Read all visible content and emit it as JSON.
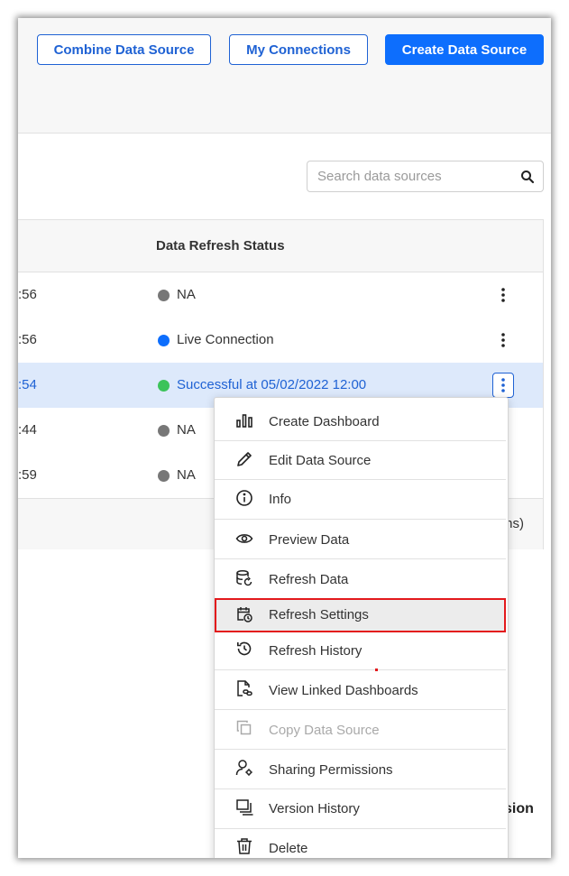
{
  "header": {
    "combine_label": "Combine Data Source",
    "connections_label": "My Connections",
    "create_label": "Create Data Source"
  },
  "search": {
    "placeholder": "Search data sources"
  },
  "table": {
    "status_header": "Data Refresh Status",
    "rows": [
      {
        "time_fragment": ":56",
        "status": "NA",
        "status_color": "#777777"
      },
      {
        "time_fragment": ":56",
        "status": "Live Connection",
        "status_color": "#0d6efd"
      },
      {
        "time_fragment": ":54",
        "status": "Successful at 05/02/2022 12:00",
        "status_color": "#3cc35a"
      },
      {
        "time_fragment": ":44",
        "status": "NA",
        "status_color": "#777777"
      },
      {
        "time_fragment": ":59",
        "status": "NA",
        "status_color": "#777777"
      }
    ],
    "footer_fragment": "ns)"
  },
  "bottom_fragment": "sion",
  "context_menu": {
    "items": [
      {
        "label": "Create Dashboard",
        "icon": "bar-chart-icon"
      },
      {
        "label": "Edit Data Source",
        "icon": "pencil-icon"
      },
      {
        "label": "Info",
        "icon": "info-icon"
      },
      {
        "label": "Preview Data",
        "icon": "eye-icon"
      },
      {
        "label": "Refresh Data",
        "icon": "database-refresh-icon"
      },
      {
        "label": "Refresh Settings",
        "icon": "calendar-clock-icon",
        "highlighted": true
      },
      {
        "label": "Refresh History",
        "icon": "history-icon"
      },
      {
        "label": "View Linked Dashboards",
        "icon": "linked-file-icon"
      },
      {
        "label": "Copy Data Source",
        "icon": "copy-icon",
        "disabled": true
      },
      {
        "label": "Sharing Permissions",
        "icon": "user-gear-icon"
      },
      {
        "label": "Version History",
        "icon": "layers-icon"
      },
      {
        "label": "Delete",
        "icon": "trash-icon"
      }
    ]
  },
  "colors": {
    "primary": "#0d6efd",
    "outline_blue": "#1f62d4",
    "selected_row": "#dde9fb",
    "highlight_border": "#e3191c"
  }
}
